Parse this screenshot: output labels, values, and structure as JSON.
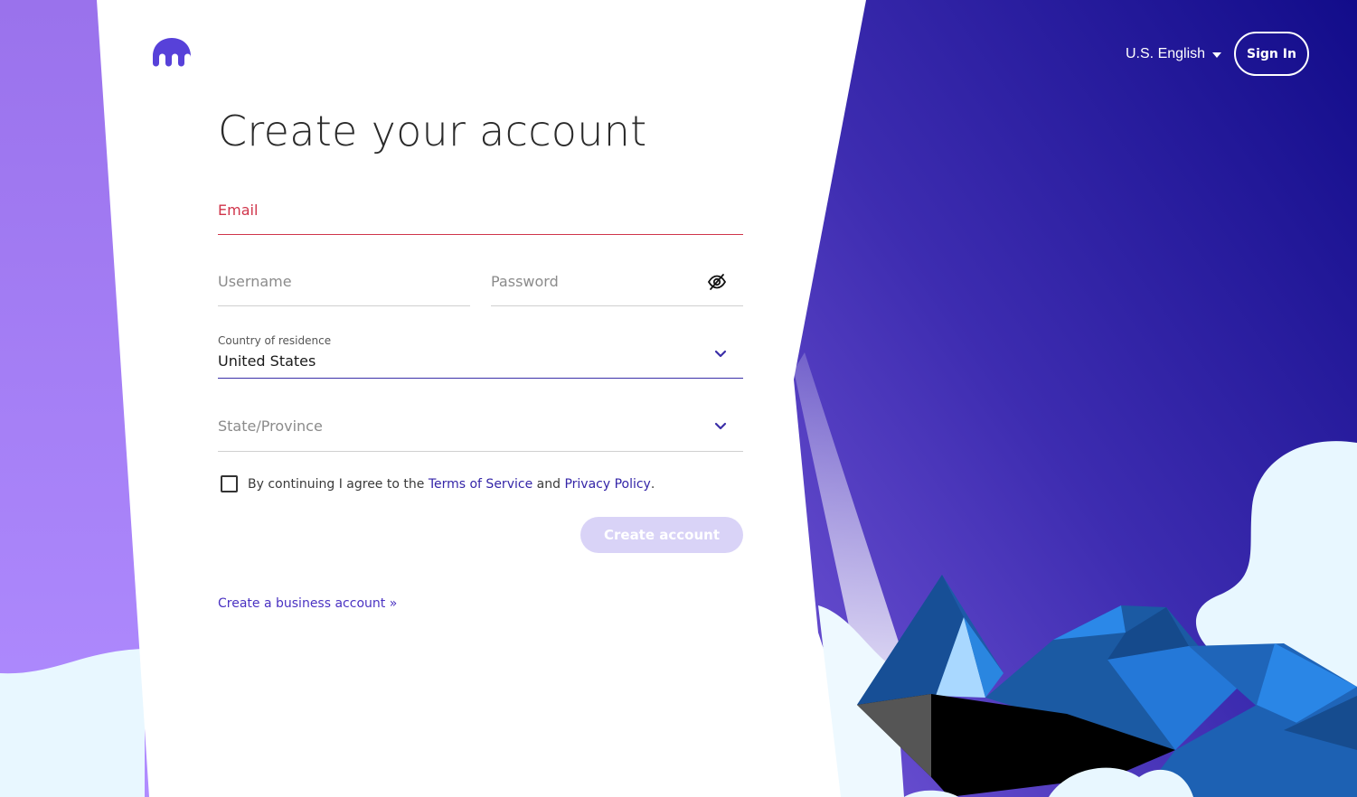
{
  "brand": {
    "logo_icon": "kraken-logo-icon",
    "accent": "#5741d9"
  },
  "header": {
    "language": "U.S. English",
    "sign_in": "Sign In"
  },
  "form": {
    "title": "Create your account",
    "email": {
      "placeholder": "Email",
      "value": ""
    },
    "username": {
      "placeholder": "Username",
      "value": ""
    },
    "password": {
      "placeholder": "Password",
      "value": "",
      "toggle_icon": "eye-slash-icon"
    },
    "country": {
      "label": "Country of residence",
      "value": "United States"
    },
    "state": {
      "placeholder": "State/Province",
      "value": ""
    },
    "agreement": {
      "prefix": "By continuing I agree to the",
      "terms": "Terms of Service",
      "and": "and",
      "privacy": "Privacy Policy",
      "suffix": ".",
      "checked": false
    },
    "submit": "Create account",
    "business_link": "Create a business account »"
  },
  "colors": {
    "error": "#d0344a",
    "link": "#3425a8",
    "button_disabled": "#d9d3f7"
  }
}
